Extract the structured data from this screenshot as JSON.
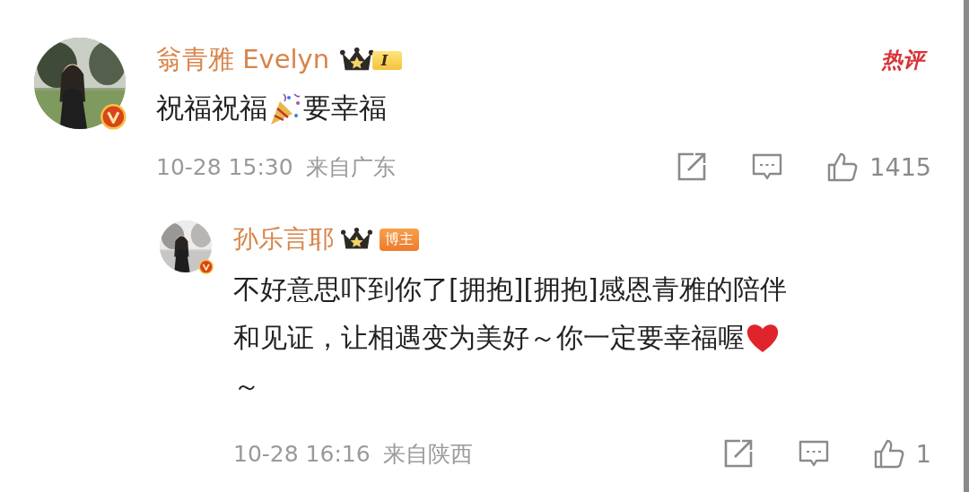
{
  "comments": [
    {
      "name": "翁青雅 Evelyn",
      "level_tag": "I",
      "hot_label": "热评",
      "verified": true,
      "text": [
        {
          "kind": "text",
          "text": "祝福祝福"
        },
        {
          "kind": "popper"
        },
        {
          "kind": "text",
          "text": "要幸福"
        }
      ],
      "time": "10-28 15:30",
      "location": "来自广东",
      "likes": "1415"
    },
    {
      "name": "孙乐言耶",
      "role_tag": "博主",
      "verified": true,
      "lines": [
        [
          {
            "kind": "text",
            "text": "不好意思吓到你了[拥抱][拥抱]感恩青雅的陪伴"
          }
        ],
        [
          {
            "kind": "text",
            "text": "和见证，让相遇变为美好～你一定要幸福喔"
          },
          {
            "kind": "heart"
          }
        ],
        [
          {
            "kind": "text",
            "text": "～"
          }
        ]
      ],
      "time": "10-28 16:16",
      "location": "来自陕西",
      "likes": "1"
    }
  ]
}
